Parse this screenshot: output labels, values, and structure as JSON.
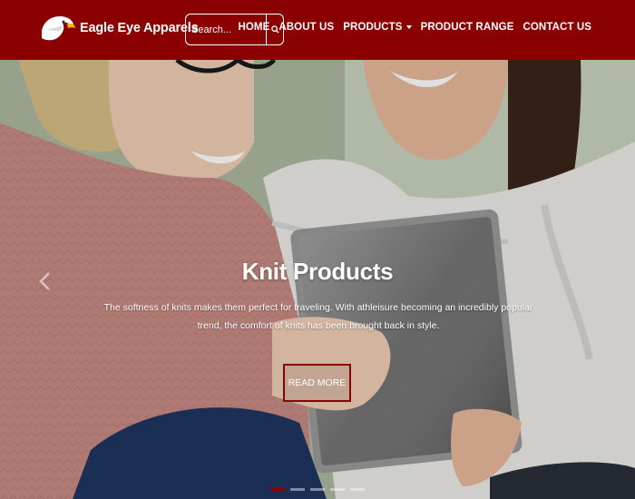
{
  "header": {
    "brand_name": "Eagle Eye Apparels",
    "search": {
      "placeholder": "Search..."
    },
    "nav": [
      {
        "label": "HOME"
      },
      {
        "label": "ABOUT US"
      },
      {
        "label": "PRODUCTS"
      },
      {
        "label": "PRODUCT RANGE"
      },
      {
        "label": "CONTACT US"
      }
    ]
  },
  "hero": {
    "title": "Knit Products",
    "description": "The softness of knits makes them perfect for traveling. With athleisure becoming an incredibly popular trend, the comfort of knits has been brought back in style.",
    "button_label": "READ MORE",
    "slide_count": 5,
    "active_slide": 1
  },
  "colors": {
    "brand": "#8b0000",
    "text_light": "#ffffff"
  },
  "icons": {
    "logo": "eagle-head-logo",
    "search": "search-icon",
    "caret": "chevron-down-icon",
    "prev": "chevron-left-icon"
  }
}
